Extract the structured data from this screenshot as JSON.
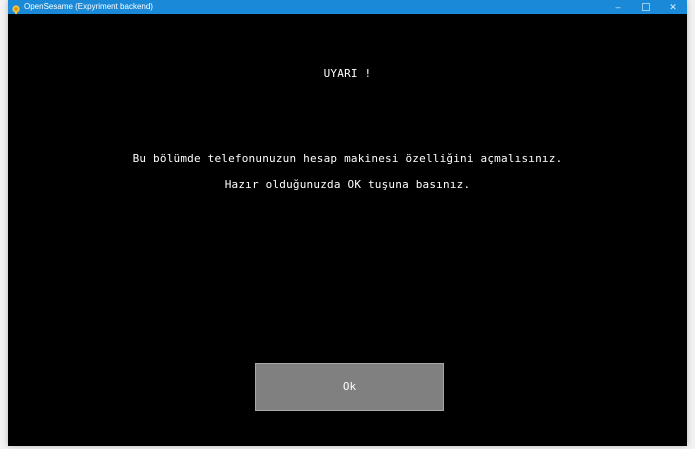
{
  "window": {
    "title": "OpenSesame (Expyriment backend)",
    "app_icon": "opensesame-icon",
    "controls": {
      "minimize": "–",
      "maximize_icon": "maximize-icon",
      "close": "✕"
    }
  },
  "experiment": {
    "warning_title": "UYARI !",
    "message_line1": "Bu bölümde telefonunuzun hesap makinesi özelliğini açmalısınız.",
    "message_line2": "Hazır olduğunuzda OK tuşuna basınız.",
    "ok_button_label": "Ok"
  },
  "colors": {
    "titlebar": "#1a8ad8",
    "background": "#000000",
    "button": "#808080",
    "text": "#ffffff"
  }
}
